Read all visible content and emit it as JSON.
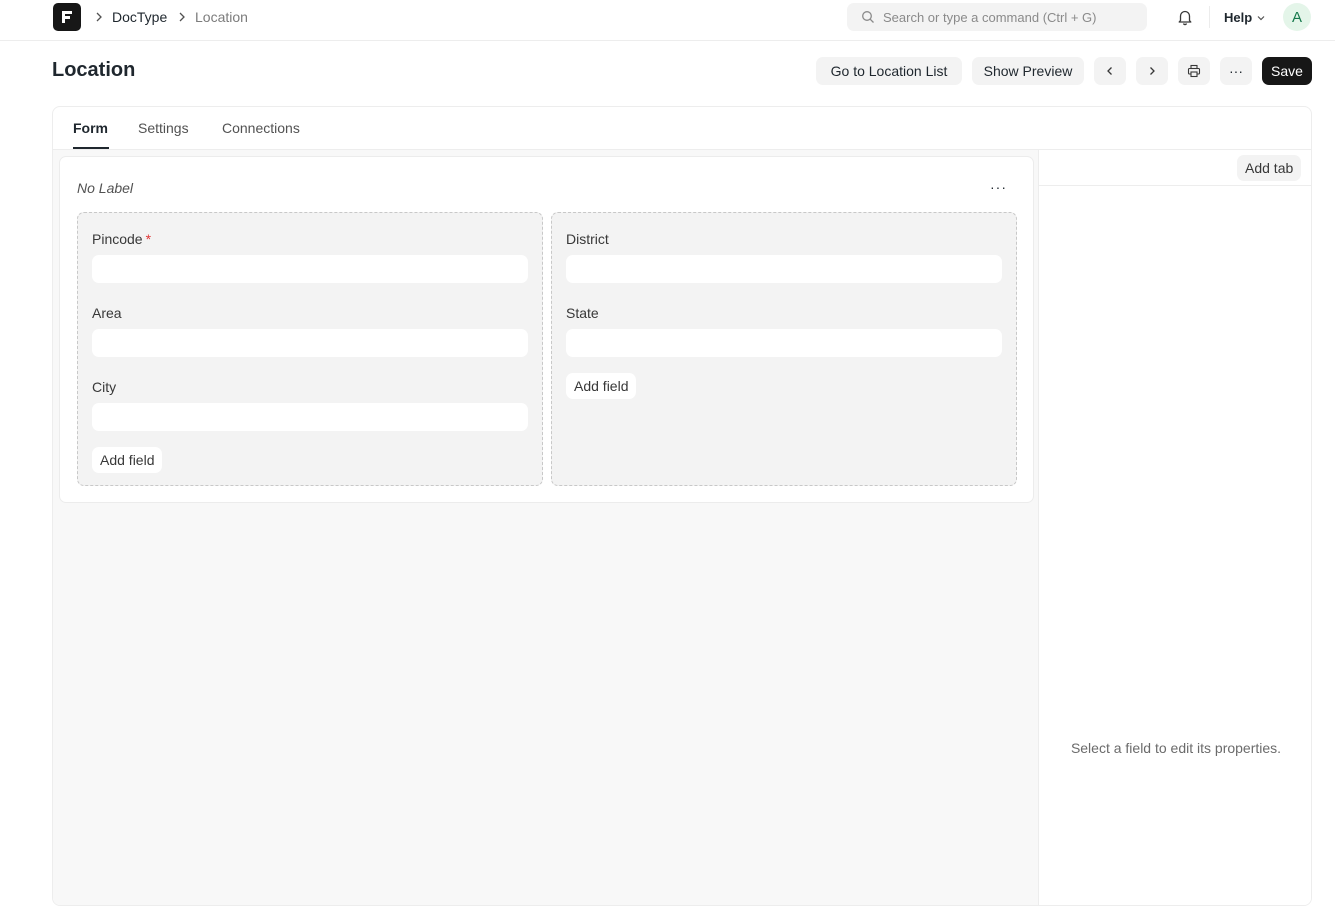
{
  "breadcrumbs": [
    {
      "label": "DocType"
    },
    {
      "label": "Location"
    }
  ],
  "search": {
    "placeholder": "Search or type a command (Ctrl + G)"
  },
  "help": {
    "label": "Help"
  },
  "user": {
    "avatar_letter": "A"
  },
  "page": {
    "title": "Location"
  },
  "toolbar": {
    "go_to_list_label": "Go to Location List",
    "show_preview_label": "Show Preview",
    "more_label": "···",
    "save_label": "Save"
  },
  "tabs": [
    {
      "label": "Form",
      "active": true
    },
    {
      "label": "Settings",
      "active": false
    },
    {
      "label": "Connections",
      "active": false
    }
  ],
  "section": {
    "label": "No Label",
    "more_label": "···",
    "columns": [
      {
        "fields": [
          {
            "label": "Pincode",
            "required": true,
            "required_mark": "*"
          },
          {
            "label": "Area",
            "required": false
          },
          {
            "label": "City",
            "required": false
          }
        ],
        "add_field_label": "Add field"
      },
      {
        "fields": [
          {
            "label": "District",
            "required": false
          },
          {
            "label": "State",
            "required": false
          }
        ],
        "add_field_label": "Add field"
      }
    ]
  },
  "sidebar": {
    "add_tab_label": "Add tab",
    "hint": "Select a field to edit its properties."
  },
  "colors": {
    "primary": "#171717",
    "required": "#e03636",
    "avatar_bg": "#e4f5e9",
    "avatar_fg": "#16794c"
  },
  "icons": {
    "logo": "frappe-logo-icon",
    "search": "search-icon",
    "bell": "bell-icon",
    "chevron": "chevron-down-icon",
    "prev": "chevron-left-icon",
    "next": "chevron-right-icon",
    "print": "printer-icon"
  }
}
